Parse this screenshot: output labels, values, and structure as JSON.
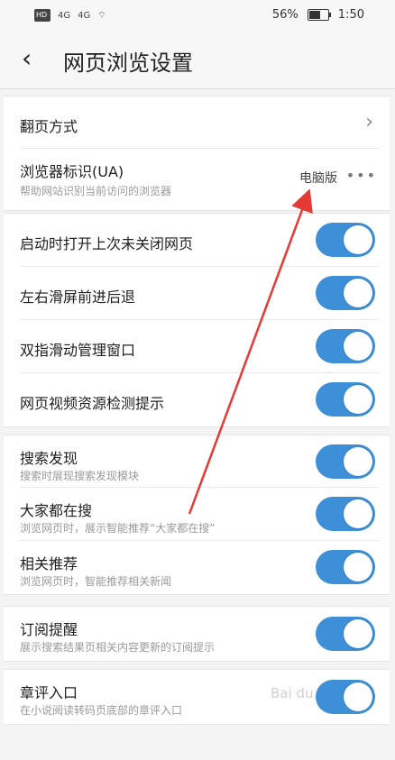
{
  "status_bar": {
    "signal_1": "4G",
    "signal_2": "4G",
    "battery_percent": "56%",
    "battery_level": 0.56,
    "time": "1:50"
  },
  "header": {
    "title": "网页浏览设置",
    "back_icon": "back-chevron"
  },
  "groups": [
    {
      "rows": [
        {
          "label": "翻页方式",
          "type": "nav"
        },
        {
          "label": "浏览器标识(UA)",
          "subtitle": "帮助网站识别当前访问的浏览器",
          "value": "电脑版",
          "type": "more"
        }
      ]
    },
    {
      "rows": [
        {
          "label": "启动时打开上次未关闭网页",
          "toggle_on": true
        },
        {
          "label": "左右滑屏前进后退",
          "toggle_on": true
        },
        {
          "label": "双指滑动管理窗口",
          "toggle_on": true
        },
        {
          "label": "网页视频资源检测提示",
          "toggle_on": true
        }
      ]
    },
    {
      "rows": [
        {
          "label": "搜索发现",
          "subtitle": "搜索时展现搜索发现模块",
          "toggle_on": true
        },
        {
          "label": "大家都在搜",
          "subtitle": "浏览网页时，展示智能推荐“大家都在搜”",
          "toggle_on": true
        },
        {
          "label": "相关推荐",
          "subtitle": "浏览网页时，智能推荐相关新闻",
          "toggle_on": true
        }
      ]
    },
    {
      "rows": [
        {
          "label": "订阅提醒",
          "subtitle": "展示搜索结果页相关内容更新的订阅提示",
          "toggle_on": true
        }
      ]
    },
    {
      "rows": [
        {
          "label": "章评入口",
          "subtitle": "在小说阅读转码页底部的章评入口",
          "toggle_on": true
        }
      ]
    }
  ],
  "colors": {
    "toggle_on": "#3d90d8",
    "annotation_arrow": "#e53935"
  }
}
